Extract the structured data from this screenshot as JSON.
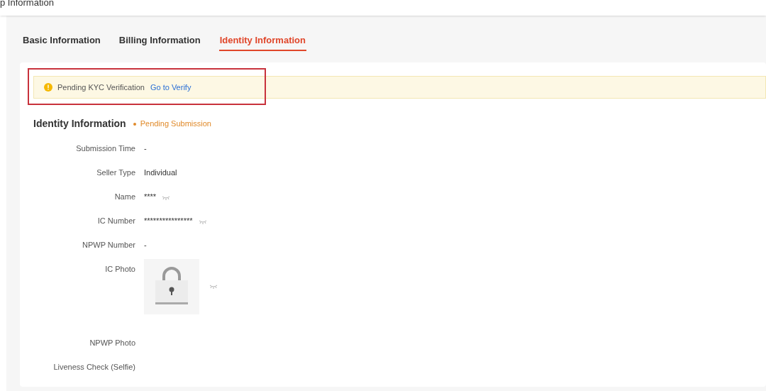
{
  "page_title": "p Information",
  "tabs": [
    {
      "label": "Basic Information",
      "selected": false
    },
    {
      "label": "Billing Information",
      "selected": false
    },
    {
      "label": "Identity Information",
      "selected": true
    }
  ],
  "alert": {
    "message": "Pending KYC Verification",
    "link": "Go to Verify",
    "highlighted": true
  },
  "section": {
    "title": "Identity Information",
    "status": "Pending Submission"
  },
  "fields": [
    {
      "label": "Submission Time",
      "kind": "text",
      "value": "-"
    },
    {
      "label": "Seller Type",
      "kind": "text",
      "value": "Individual"
    },
    {
      "label": "Name",
      "kind": "masked",
      "value": "****"
    },
    {
      "label": "IC Number",
      "kind": "masked",
      "value": "****************"
    },
    {
      "label": "NPWP Number",
      "kind": "text",
      "value": "-"
    },
    {
      "label": "IC Photo",
      "kind": "photo"
    },
    {
      "label": "NPWP Photo",
      "kind": "empty"
    },
    {
      "label": "Liveness Check (Selfie)",
      "kind": "empty"
    }
  ]
}
